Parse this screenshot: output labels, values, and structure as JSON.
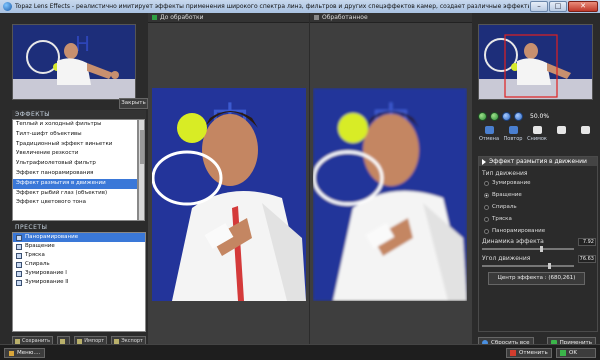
{
  "window": {
    "title": "Topaz Lens Effects - реалистично имитирует эффекты применения широкого спектра линз, фильтров и других спецэффектов камер, создает различные эффекты без дополнительного оборудования."
  },
  "left": {
    "close_label": "Закрыть",
    "effects_title": "ЭФФЕКТЫ",
    "effects": [
      "Теплый и холодный фильтры",
      "Тилт-шифт объективы",
      "Традиционный эффект виньетки",
      "Увеличение резкости",
      "Ультрафиолетовый фильтр",
      "Эффект панорамирования",
      "Эффект размытия в движении",
      "Эффект рыбий глаз (объектив)",
      "Эффект цветового тона"
    ],
    "selected_effect_index": 6,
    "presets_title": "ПРЕСЕТЫ",
    "presets": [
      "Панорамирование",
      "Вращение",
      "Тряска",
      "Спираль",
      "Зумирование I",
      "Зумирование II"
    ],
    "selected_preset_index": 0,
    "buttons": {
      "save": "Сохранить",
      "import": "Импорт",
      "export": "Экспорт"
    }
  },
  "views": {
    "before": "До обработки",
    "after": "Обработанное"
  },
  "right": {
    "zoom": "50.0%",
    "history": {
      "undo": "Отмена",
      "redo": "Повтор",
      "snapshot": "Снимок"
    },
    "settings": {
      "header": "Эффект размытия в движении",
      "motion_type_label": "Тип движения",
      "motion_types": [
        "Зумирование",
        "Вращение",
        "Спираль",
        "Тряска",
        "Панорамирование"
      ],
      "selected_motion_index": 1,
      "dynamics_label": "Динамика эффекта",
      "dynamics_value": "7.92",
      "angle_label": "Угол движения",
      "angle_value": "76.63",
      "center_button": "Центр эффекта : (680,261)"
    },
    "reset_all": "Сбросить все",
    "apply": "Применить"
  },
  "statusbar": {
    "menu": "Меню....",
    "cancel": "Отменить",
    "ok": "OK"
  },
  "colors": {
    "selection": "#3a78d8",
    "apply_icon": "#3bb54a",
    "cancel_icon": "#d23d2e"
  }
}
